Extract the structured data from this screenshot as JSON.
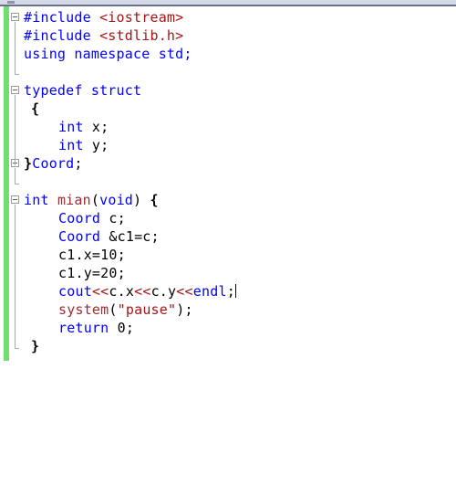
{
  "window": {
    "app": "code-editor",
    "toolbar_strip_color": "#d6dae8",
    "toolbar_rule_color": "#6b7189"
  },
  "gutter": {
    "change_bar_color": "#6fe06f",
    "change_bar_title": "modified-lines-indicator",
    "fold_markers": [
      {
        "name": "fold-marker-include-block",
        "line": 1,
        "state": "expanded",
        "glyph": "-"
      },
      {
        "name": "fold-marker-typedef-struct",
        "line": 5,
        "state": "expanded",
        "glyph": "-"
      },
      {
        "name": "fold-marker-struct-end",
        "line": 9,
        "state": "expanded",
        "glyph": "-"
      },
      {
        "name": "fold-marker-main-function",
        "line": 11,
        "state": "expanded",
        "glyph": "-"
      }
    ]
  },
  "colors": {
    "keyword": "#0000ff",
    "string": "#a31515",
    "header": "#a31515",
    "function": "#9b2d30",
    "operator": "#a31515",
    "plain": "#000000",
    "background": "#ffffff",
    "fold_line": "#a9a9a9"
  },
  "editor": {
    "language": "C++",
    "caret_line": 16,
    "caret_after_text": "cout<<c.x<<c.y<<endl;",
    "lines": [
      {
        "n": 1,
        "indent": 0,
        "tokens": [
          {
            "t": "#include ",
            "c": "pp"
          },
          {
            "t": "<iostream>",
            "c": "hdr"
          }
        ]
      },
      {
        "n": 2,
        "indent": 0,
        "tokens": [
          {
            "t": "#include ",
            "c": "pp"
          },
          {
            "t": "<stdlib.h>",
            "c": "hdr"
          }
        ]
      },
      {
        "n": 3,
        "indent": 0,
        "tokens": [
          {
            "t": "using namespace std;",
            "c": "kw"
          }
        ]
      },
      {
        "n": 4,
        "indent": 0,
        "tokens": []
      },
      {
        "n": 5,
        "indent": 0,
        "tokens": [
          {
            "t": "typedef struct",
            "c": "kw"
          }
        ]
      },
      {
        "n": 6,
        "indent": 1,
        "tokens": [
          {
            "t": "{",
            "c": "brace"
          }
        ]
      },
      {
        "n": 7,
        "indent": 2,
        "tokens": [
          {
            "t": "int",
            "c": "kw"
          },
          {
            "t": " x;",
            "c": "plain"
          }
        ]
      },
      {
        "n": 8,
        "indent": 2,
        "tokens": [
          {
            "t": "int",
            "c": "kw"
          },
          {
            "t": " y;",
            "c": "plain"
          }
        ]
      },
      {
        "n": 9,
        "indent": 0,
        "tokens": [
          {
            "t": "}",
            "c": "brace"
          },
          {
            "t": "Coord",
            "c": "kw"
          },
          {
            "t": ";",
            "c": "plain"
          }
        ]
      },
      {
        "n": 10,
        "indent": 0,
        "tokens": []
      },
      {
        "n": 11,
        "indent": 0,
        "tokens": [
          {
            "t": "int",
            "c": "kw"
          },
          {
            "t": " ",
            "c": "plain"
          },
          {
            "t": "mian",
            "c": "fn"
          },
          {
            "t": "(",
            "c": "plain"
          },
          {
            "t": "void",
            "c": "kw"
          },
          {
            "t": ")",
            "c": "plain"
          },
          {
            "t": " ",
            "c": "plain"
          },
          {
            "t": "{",
            "c": "brace"
          }
        ]
      },
      {
        "n": 12,
        "indent": 2,
        "tokens": [
          {
            "t": "Coord",
            "c": "kw"
          },
          {
            "t": " c;",
            "c": "plain"
          }
        ]
      },
      {
        "n": 13,
        "indent": 2,
        "tokens": [
          {
            "t": "Coord",
            "c": "kw"
          },
          {
            "t": " &c1=c;",
            "c": "plain"
          }
        ]
      },
      {
        "n": 14,
        "indent": 2,
        "tokens": [
          {
            "t": "c1.x=10;",
            "c": "plain"
          }
        ]
      },
      {
        "n": 15,
        "indent": 2,
        "tokens": [
          {
            "t": "c1.y=20;",
            "c": "plain"
          }
        ]
      },
      {
        "n": 16,
        "indent": 2,
        "tokens": [
          {
            "t": "cout",
            "c": "kw"
          },
          {
            "t": "<<",
            "c": "op"
          },
          {
            "t": "c.x",
            "c": "plain"
          },
          {
            "t": "<<",
            "c": "op"
          },
          {
            "t": "c.y",
            "c": "plain"
          },
          {
            "t": "<<",
            "c": "op"
          },
          {
            "t": "endl",
            "c": "kw"
          },
          {
            "t": ";",
            "c": "plain"
          }
        ],
        "caret": true
      },
      {
        "n": 17,
        "indent": 2,
        "tokens": [
          {
            "t": "system",
            "c": "fn"
          },
          {
            "t": "(",
            "c": "plain"
          },
          {
            "t": "\"pause\"",
            "c": "str"
          },
          {
            "t": ")",
            "c": "plain"
          },
          {
            "t": ";",
            "c": "plain"
          }
        ]
      },
      {
        "n": 18,
        "indent": 2,
        "tokens": [
          {
            "t": "return",
            "c": "kw"
          },
          {
            "t": " 0;",
            "c": "plain"
          }
        ]
      },
      {
        "n": 19,
        "indent": 1,
        "tokens": [
          {
            "t": "}",
            "c": "brace"
          }
        ]
      }
    ]
  }
}
